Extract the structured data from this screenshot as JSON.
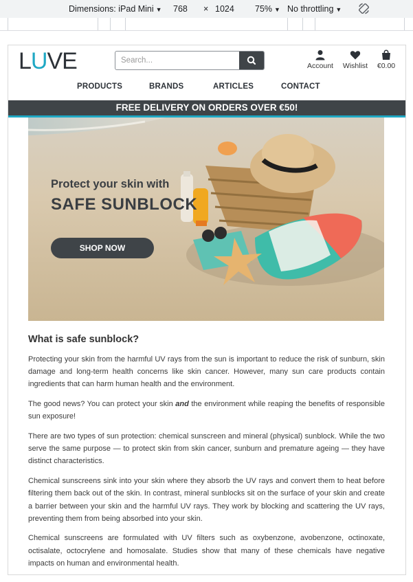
{
  "devtools": {
    "dimensions_label": "Dimensions: iPad Mini",
    "width": "768",
    "times": "×",
    "height": "1024",
    "zoom": "75%",
    "throttling": "No throttling",
    "rotate_icon": "rotate-icon"
  },
  "site": {
    "logo_prefix": "L",
    "logo_accent": "U",
    "logo_suffix": "VE",
    "search_placeholder": "Search...",
    "account_label": "Account",
    "wishlist_label": "Wishlist",
    "cart_total": "€0.00",
    "nav": [
      "PRODUCTS",
      "BRANDS",
      "ARTICLES",
      "CONTACT"
    ],
    "delivery_banner": "FREE DELIVERY ON ORDERS OVER €50!",
    "colors": {
      "accent": "#1fa8c4",
      "dark": "#3f4448"
    }
  },
  "hero": {
    "subtitle": "Protect your skin with",
    "title": "SAFE SUNBLOCK",
    "button": "SHOP NOW"
  },
  "article": {
    "heading": "What is safe sunblock?",
    "p1": "Protecting your skin from the harmful UV rays from the sun is important to reduce the risk of sunburn, skin damage and long-term health concerns like skin cancer. However, many sun care products contain ingredients that can harm human health and the environment.",
    "p2_before": "The good news? You can protect your skin ",
    "p2_em": "and",
    "p2_after": " the environment while reaping the benefits of responsible sun exposure!",
    "p3": "There are two types of sun protection: chemical sunscreen and mineral (physical) sunblock. While the two serve the same purpose — to protect skin from skin cancer, sunburn and premature ageing — they have distinct characteristics.",
    "p4": "Chemical sunscreens sink into your skin where they absorb the UV rays and convert them to heat before filtering them back out of the skin. In contrast, mineral sunblocks sit on the surface of your skin and create a barrier between your skin and the harmful UV rays. They work by blocking and scattering the UV rays, preventing them from being absorbed into your skin.",
    "p5": "Chemical sunscreens are formulated with UV filters such as oxybenzone, avobenzone, octinoxate, octisalate, octocrylene and homosalate. Studies show that many of these chemicals have negative impacts on human and environmental health."
  }
}
